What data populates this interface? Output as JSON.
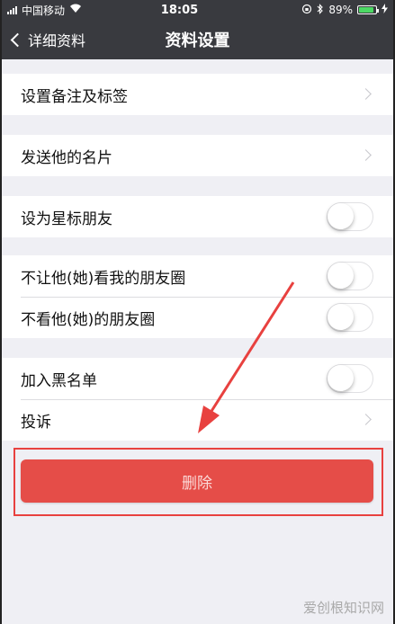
{
  "status_bar": {
    "carrier": "中国移动",
    "time": "18:05",
    "battery": "89%",
    "battery_level": 0.89,
    "icons": [
      "signal-icon",
      "wifi-icon",
      "rotation-lock-icon",
      "bluetooth-icon",
      "battery-icon",
      "charging-icon"
    ]
  },
  "nav": {
    "back_label": "详细资料",
    "title": "资料设置"
  },
  "groups": [
    {
      "items": [
        {
          "label": "设置备注及标签",
          "control": "chevron"
        }
      ]
    },
    {
      "items": [
        {
          "label": "发送他的名片",
          "control": "chevron"
        }
      ]
    },
    {
      "items": [
        {
          "label": "设为星标朋友",
          "control": "toggle",
          "on": false
        }
      ]
    },
    {
      "items": [
        {
          "label": "不让他(她)看我的朋友圈",
          "control": "toggle",
          "on": false
        },
        {
          "label": "不看他(她)的朋友圈",
          "control": "toggle",
          "on": false
        }
      ]
    },
    {
      "items": [
        {
          "label": "加入黑名单",
          "control": "toggle",
          "on": false
        },
        {
          "label": "投诉",
          "control": "chevron"
        }
      ]
    }
  ],
  "delete_button": {
    "label": "删除"
  },
  "annotation": {
    "color": "#e8413f"
  },
  "watermark": "爱创根知识网",
  "colors": {
    "nav_bg": "#393a3f",
    "page_bg": "#efeff4",
    "danger": "#e54d48",
    "battery": "#4cd964"
  }
}
